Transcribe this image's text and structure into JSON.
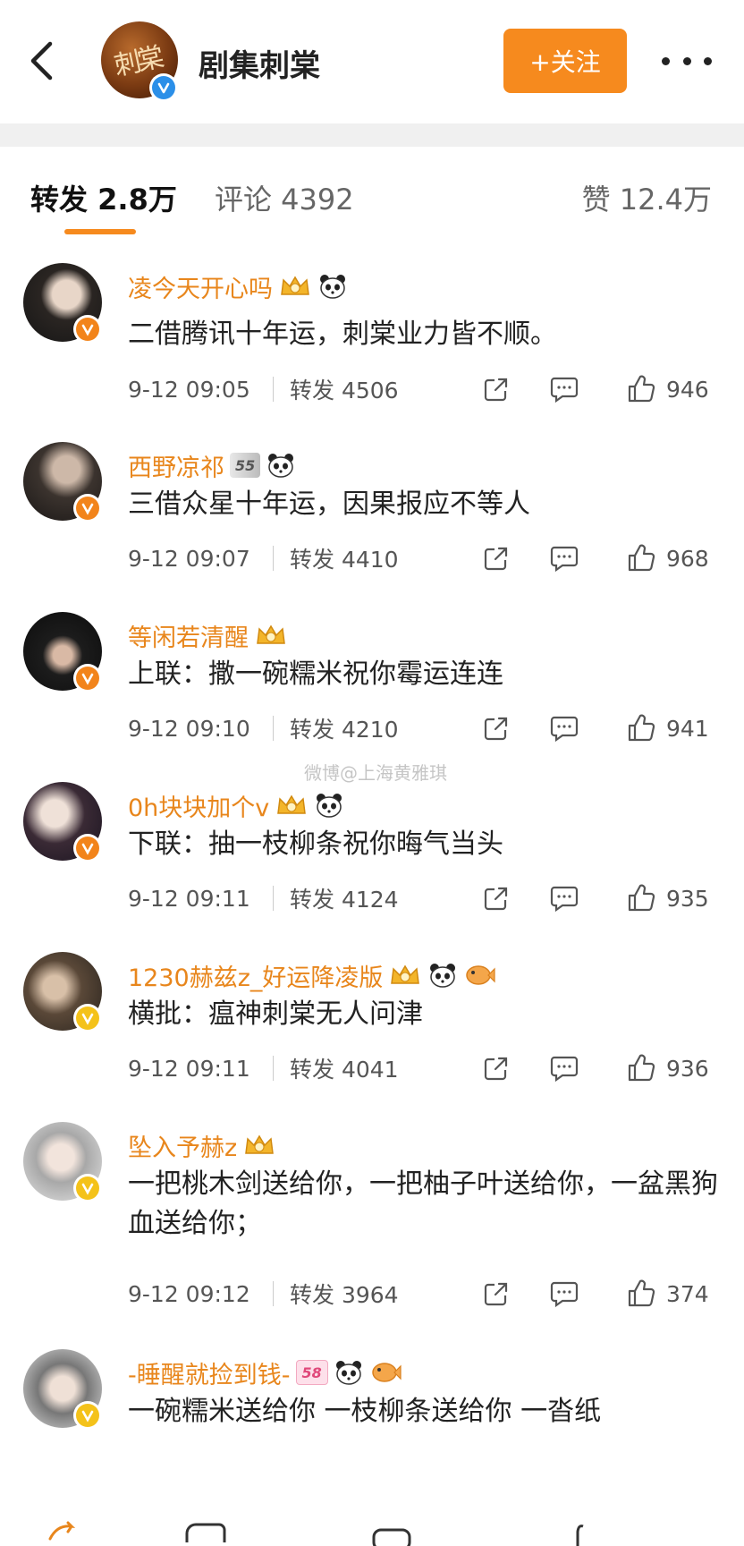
{
  "header": {
    "account_name": "剧集刺棠",
    "logo_text": "刺棠",
    "follow_label": "+关注",
    "icons": [
      "back-arrow-icon",
      "verified-icon",
      "more-icon"
    ]
  },
  "tabs": {
    "repost": "转发 2.8万",
    "comment": "评论 4392",
    "like": "赞 12.4万",
    "active": "repost",
    "accent": "#f68a1e"
  },
  "labels": {
    "repost_prefix": "转发"
  },
  "comments": [
    {
      "user": "凌今天开心吗",
      "text": "二借腾讯十年运，刺棠业力皆不顺。",
      "time": "9-12 09:05",
      "reposts": "转发 4506",
      "likes": "946",
      "badge": "orange",
      "medals": [
        "crown",
        "panda"
      ]
    },
    {
      "user": "西野凉祁",
      "text": "三借众星十年运，因果报应不等人",
      "time": "9-12 09:07",
      "reposts": "转发 4410",
      "likes": "968",
      "badge": "orange",
      "medals": [
        "level-55",
        "panda"
      ],
      "medal_text": "55"
    },
    {
      "user": "等闲若清醒",
      "text": "上联：撒一碗糯米祝你霉运连连",
      "time": "9-12 09:10",
      "reposts": "转发 4210",
      "likes": "941",
      "badge": "orange",
      "medals": [
        "crown"
      ]
    },
    {
      "user": "0h块块加个v",
      "text": "下联：抽一枝柳条祝你晦气当头",
      "time": "9-12 09:11",
      "reposts": "转发 4124",
      "likes": "935",
      "badge": "orange",
      "medals": [
        "crown",
        "panda"
      ]
    },
    {
      "user": "1230赫兹z_好运降凌版",
      "text": "横批：瘟神刺棠无人问津",
      "time": "9-12 09:11",
      "reposts": "转发 4041",
      "likes": "936",
      "badge": "yellow",
      "medals": [
        "crown",
        "panda",
        "fish"
      ]
    },
    {
      "user": "坠入予赫z",
      "text": "一把桃木剑送给你，一把柚子叶送给你，一盆黑狗血送给你；",
      "time": "9-12 09:12",
      "reposts": "转发 3964",
      "likes": "374",
      "badge": "yellow",
      "medals": [
        "crown"
      ]
    },
    {
      "user": "-睡醒就捡到钱-",
      "text": "一碗糯米送给你 一枝柳条送给你 一沓纸",
      "badge": "yellow",
      "medals": [
        "level-58",
        "panda",
        "fish"
      ],
      "medal_text": "58"
    }
  ],
  "watermark": "微博@上海黄雅琪"
}
